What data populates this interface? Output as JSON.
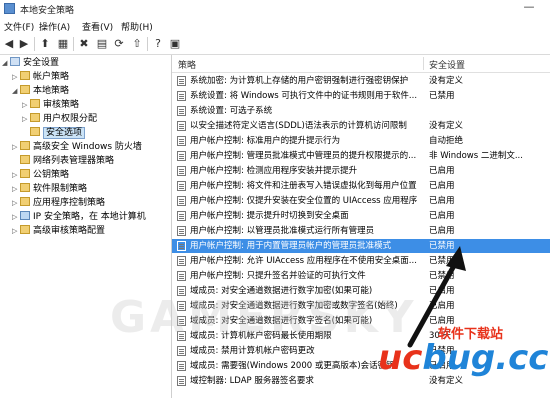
{
  "window": {
    "title": "本地安全策略",
    "minimize_glyph": "—"
  },
  "menu": [
    "文件(F)",
    "操作(A)",
    "查看(V)",
    "帮助(H)"
  ],
  "toolbar": [
    {
      "name": "back-icon",
      "glyph": "◀"
    },
    {
      "name": "forward-icon",
      "glyph": "▶"
    },
    {
      "name": "up-folder-icon",
      "glyph": "⬆"
    },
    {
      "name": "show-tree-icon",
      "glyph": "▦"
    },
    {
      "name": "delete-icon",
      "glyph": "✖"
    },
    {
      "name": "properties-icon",
      "glyph": "▤"
    },
    {
      "name": "refresh-icon",
      "glyph": "⟳"
    },
    {
      "name": "export-icon",
      "glyph": "⇧"
    },
    {
      "name": "help-icon",
      "glyph": "?"
    },
    {
      "name": "view-icon",
      "glyph": "▣"
    }
  ],
  "tree": [
    {
      "label": "安全设置",
      "expander": "◢",
      "icon": "sec"
    },
    {
      "label": "帐户策略",
      "expander": "▷",
      "icon": "fold"
    },
    {
      "label": "本地策略",
      "expander": "◢",
      "icon": "fold"
    },
    {
      "label": "审核策略",
      "expander": "▷",
      "icon": "fold"
    },
    {
      "label": "用户权限分配",
      "expander": "▷",
      "icon": "fold"
    },
    {
      "label": "安全选项",
      "expander": "",
      "icon": "fold",
      "selected": true
    },
    {
      "label": "高级安全 Windows 防火墙",
      "expander": "▷",
      "icon": "fold"
    },
    {
      "label": "网络列表管理器策略",
      "expander": "",
      "icon": "fold"
    },
    {
      "label": "公钥策略",
      "expander": "▷",
      "icon": "fold"
    },
    {
      "label": "软件限制策略",
      "expander": "▷",
      "icon": "fold"
    },
    {
      "label": "应用程序控制策略",
      "expander": "▷",
      "icon": "fold"
    },
    {
      "label": "IP 安全策略，在 本地计算机",
      "expander": "▷",
      "icon": "pc"
    },
    {
      "label": "高级审核策略配置",
      "expander": "▷",
      "icon": "fold"
    }
  ],
  "list": {
    "header_policy": "策略",
    "header_setting": "安全设置",
    "rows": [
      {
        "policy": "系统加密: 为计算机上存储的用户密钥强制进行强密钥保护",
        "setting": "没有定义"
      },
      {
        "policy": "系统设置: 将 Windows 可执行文件中的证书规则用于软件...",
        "setting": "已禁用"
      },
      {
        "policy": "系统设置: 可选子系统",
        "setting": ""
      },
      {
        "policy": "以安全描述符定义语言(SDDL)语法表示的计算机访问限制",
        "setting": "没有定义"
      },
      {
        "policy": "用户帐户控制: 标准用户的提升提示行为",
        "setting": "自动拒绝"
      },
      {
        "policy": "用户帐户控制: 管理员批准模式中管理员的提升权限提示的...",
        "setting": "非 Windows 二进制文..."
      },
      {
        "policy": "用户帐户控制: 检测应用程序安装并提示提升",
        "setting": "已启用"
      },
      {
        "policy": "用户帐户控制: 将文件和注册表写入错误虚拟化到每用户位置",
        "setting": "已启用"
      },
      {
        "policy": "用户帐户控制: 仅提升安装在安全位置的 UIAccess 应用程序",
        "setting": "已启用"
      },
      {
        "policy": "用户帐户控制: 提示提升时切换到安全桌面",
        "setting": "已启用"
      },
      {
        "policy": "用户帐户控制: 以管理员批准模式运行所有管理员",
        "setting": "已启用"
      },
      {
        "policy": "用户帐户控制: 用于内置管理员帐户的管理员批准模式",
        "setting": "已禁用",
        "selected": true
      },
      {
        "policy": "用户帐户控制: 允许 UIAccess 应用程序在不使用安全桌面...",
        "setting": "已禁用"
      },
      {
        "policy": "用户帐户控制: 只提升签名并验证的可执行文件",
        "setting": "已禁用"
      },
      {
        "policy": "域成员: 对安全通道数据进行数字加密(如果可能)",
        "setting": "已启用"
      },
      {
        "policy": "域成员: 对安全通道数据进行数字加密或数字签名(始终)",
        "setting": "已启用"
      },
      {
        "policy": "域成员: 对安全通道数据进行数字签名(如果可能)",
        "setting": "已启用"
      },
      {
        "policy": "域成员: 计算机帐户密码最长使用期限",
        "setting": "30 天"
      },
      {
        "policy": "域成员: 禁用计算机帐户密码更改",
        "setting": "已禁用"
      },
      {
        "policy": "域成员: 需要强(Windows 2000 或更高版本)会话密钥",
        "setting": "已启用"
      },
      {
        "policy": "域控制器: LDAP 服务器签名要求",
        "setting": "没有定义"
      }
    ]
  },
  "watermark": "GAMERSKY",
  "logo": {
    "sub": "软件下载站",
    "brand_u": "uc",
    "brand_c": "bug.cc",
    "url": "http://www.uebug.cc"
  }
}
